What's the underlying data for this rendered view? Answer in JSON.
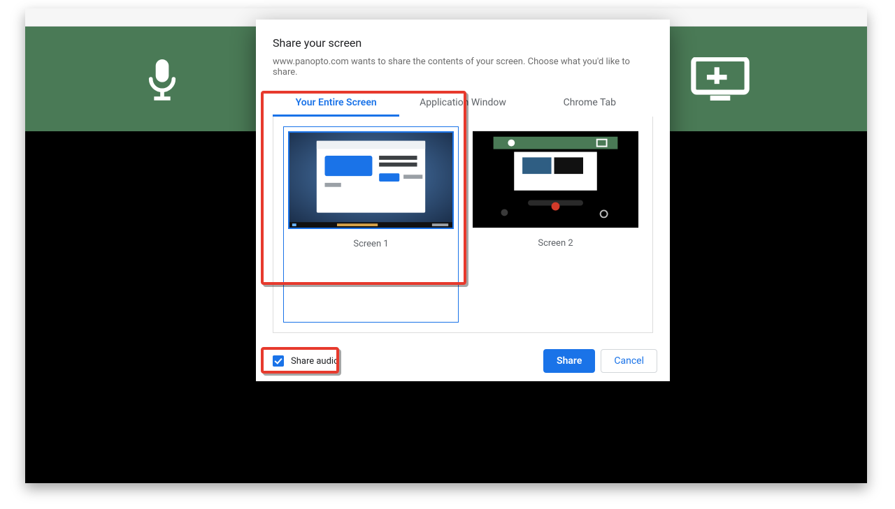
{
  "dialog": {
    "title": "Share your screen",
    "subtitle": "www.panopto.com wants to share the contents of your screen. Choose what you'd like to share.",
    "tabs": [
      {
        "label": "Your Entire Screen",
        "active": true
      },
      {
        "label": "Application Window",
        "active": false
      },
      {
        "label": "Chrome Tab",
        "active": false
      }
    ],
    "screens": [
      {
        "label": "Screen 1",
        "selected": true
      },
      {
        "label": "Screen 2",
        "selected": false
      }
    ],
    "share_audio_label": "Share audio",
    "share_audio_checked": true,
    "share_label": "Share",
    "cancel_label": "Cancel"
  },
  "icons": {
    "mic": "microphone-icon",
    "add_screen": "add-screen-icon",
    "camera_off": "camera-off-icon"
  },
  "colors": {
    "banner_bg": "#4a7a56",
    "accent": "#1a73e8",
    "callout": "#e73a2d"
  }
}
